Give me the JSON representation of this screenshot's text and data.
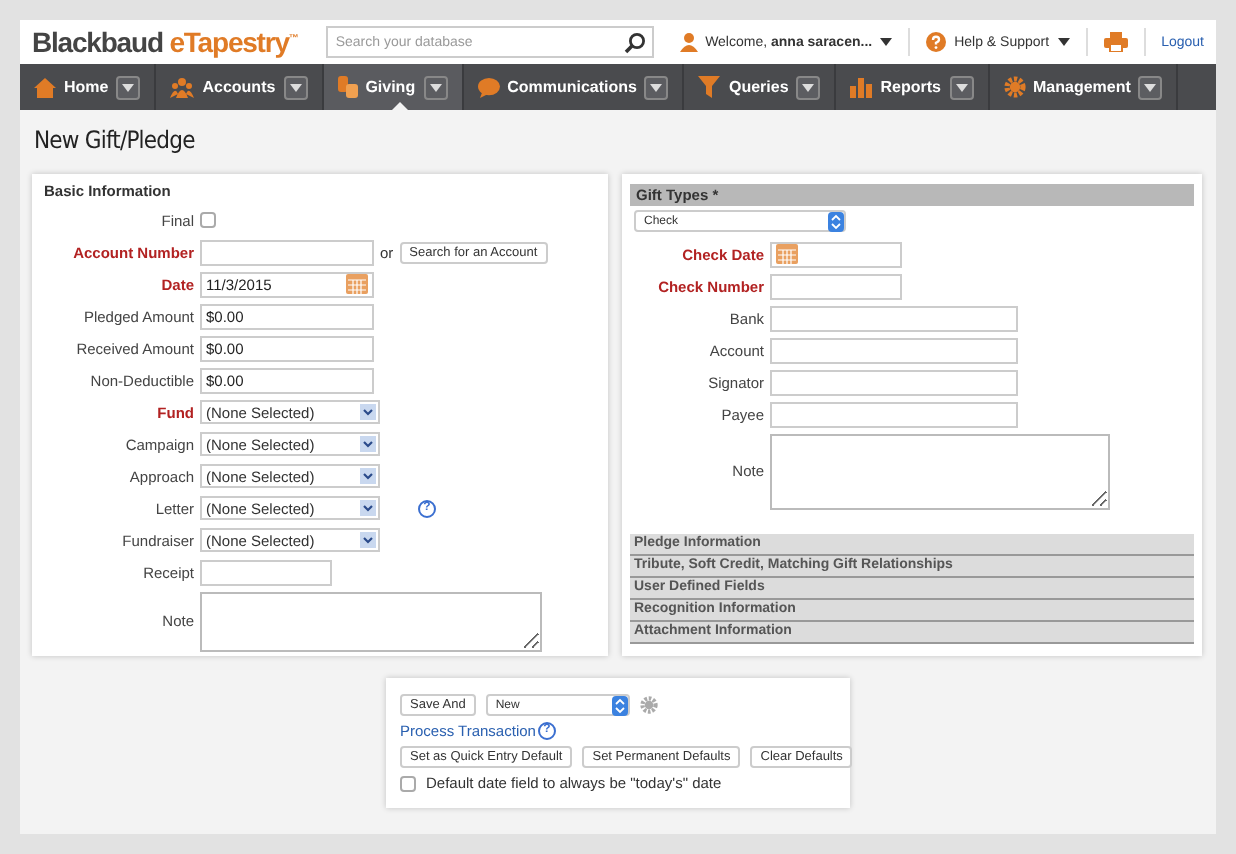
{
  "header": {
    "logo_main": "Blackbaud",
    "logo_accent": "eTapestry",
    "logo_mark": "™",
    "search_placeholder": "Search your database",
    "welcome": "Welcome, **anna saracen...**",
    "help": "Help & Support",
    "logout": "Logout"
  },
  "nav": [
    {
      "label": "Home",
      "selected": false
    },
    {
      "label": "Accounts",
      "selected": false
    },
    {
      "label": "Giving",
      "selected": true
    },
    {
      "label": "Communications",
      "selected": false
    },
    {
      "label": "Queries",
      "selected": false
    },
    {
      "label": "Reports",
      "selected": false
    },
    {
      "label": "Management",
      "selected": false
    }
  ],
  "page_title": "New Gift/Pledge",
  "basic_info": {
    "title": "Basic Information",
    "fields": [
      {
        "kind": "checkbox",
        "label": "Final",
        "required": false,
        "checked": false
      },
      {
        "kind": "lookup",
        "label": "Account Number",
        "required": true,
        "or_text": "or",
        "button": "Search for an Account"
      },
      {
        "kind": "date",
        "label": "Date",
        "required": true,
        "value": "11/3/2015"
      },
      {
        "kind": "text",
        "label": "Pledged Amount",
        "required": false,
        "value": "$0.00"
      },
      {
        "kind": "text",
        "label": "Received Amount",
        "required": false,
        "value": "$0.00"
      },
      {
        "kind": "text",
        "label": "Non-Deductible",
        "required": false,
        "value": "$0.00"
      },
      {
        "kind": "select",
        "label": "Fund",
        "required": true,
        "value": "(None Selected)"
      },
      {
        "kind": "select",
        "label": "Campaign",
        "required": false,
        "value": "(None Selected)"
      },
      {
        "kind": "select",
        "label": "Approach",
        "required": false,
        "value": "(None Selected)"
      },
      {
        "kind": "select",
        "label": "Letter",
        "required": false,
        "value": "(None Selected)",
        "help": "?"
      },
      {
        "kind": "select",
        "label": "Fundraiser",
        "required": false,
        "value": "(None Selected)"
      },
      {
        "kind": "short",
        "label": "Receipt",
        "required": false
      },
      {
        "kind": "textarea",
        "label": "Note",
        "required": false
      }
    ]
  },
  "gift_types": {
    "title": "Gift Types *",
    "type_value": "Check",
    "fields": [
      {
        "kind": "date",
        "label": "Check Date",
        "required": true
      },
      {
        "kind": "short",
        "label": "Check Number",
        "required": true
      },
      {
        "kind": "text",
        "label": "Bank",
        "required": false
      },
      {
        "kind": "text",
        "label": "Account",
        "required": false
      },
      {
        "kind": "text",
        "label": "Signator",
        "required": false
      },
      {
        "kind": "text",
        "label": "Payee",
        "required": false
      },
      {
        "kind": "textarea",
        "label": "Note",
        "required": false
      }
    ],
    "sections": [
      "Pledge Information",
      "Tribute, Soft Credit, Matching Gift Relationships",
      "User Defined Fields",
      "Recognition Information",
      "Attachment Information"
    ]
  },
  "actions": {
    "save_button": "Save And",
    "save_option": "New",
    "link": "Process Transaction",
    "link_help": "?",
    "buttons": [
      "Set as Quick Entry Default",
      "Set Permanent Defaults",
      "Clear Defaults"
    ],
    "default_date": {
      "label": "Default date field to always be \"today's\" date",
      "checked": false
    }
  }
}
